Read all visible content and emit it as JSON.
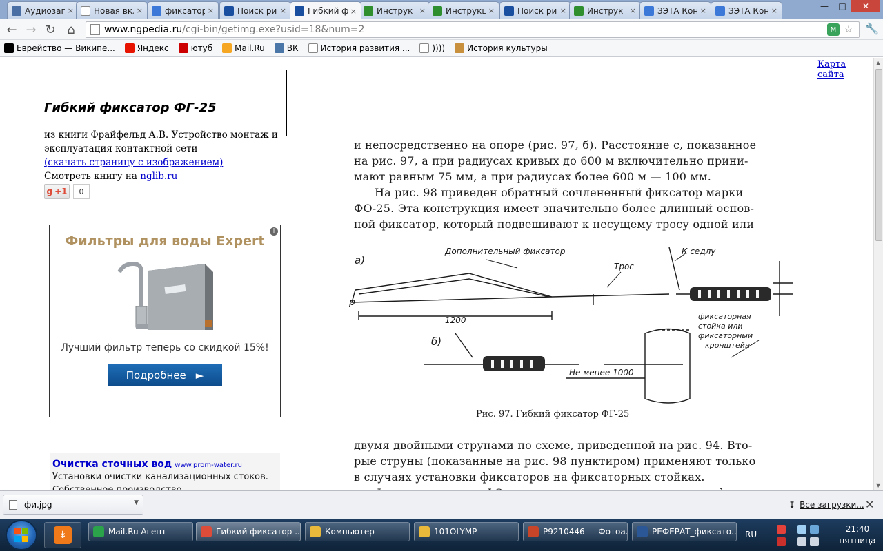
{
  "tabs": [
    {
      "label": "Аудиозаписи",
      "icon": "pause-icon",
      "color": "#4a6fa5"
    },
    {
      "label": "Новая вкладка",
      "icon": "blank-page-icon",
      "color": "#ffffff"
    },
    {
      "label": "фиксатор",
      "icon": "google-icon",
      "color": "#3c78d8"
    },
    {
      "label": "Поиск ри",
      "icon": "ngpedia-icon",
      "color": "#1a4fa0"
    },
    {
      "label": "Гибкий ф",
      "icon": "ngpedia-icon",
      "color": "#1a4fa0",
      "active": true
    },
    {
      "label": "Инструк",
      "icon": "gear-flower-icon",
      "color": "#2f8f2f"
    },
    {
      "label": "Инструкц",
      "icon": "gear-flower-icon",
      "color": "#2f8f2f"
    },
    {
      "label": "Поиск ри",
      "icon": "ngpedia-icon",
      "color": "#1a4fa0"
    },
    {
      "label": "Инструк",
      "icon": "gear-flower-icon",
      "color": "#2f8f2f"
    },
    {
      "label": "ЗЭТА Кон",
      "icon": "google-icon",
      "color": "#3c78d8"
    },
    {
      "label": "ЗЭТА Кон",
      "icon": "google-icon",
      "color": "#3c78d8"
    }
  ],
  "url": {
    "host": "www.ngpedia.ru",
    "path": "/cgi-bin/getimg.exe?usid=18&num=2"
  },
  "bookmarks": [
    {
      "label": "Еврейство — Википе...",
      "icon": "wikipedia-icon",
      "color": "#000000"
    },
    {
      "label": "Яндекс",
      "icon": "yandex-icon",
      "color": "#e61400"
    },
    {
      "label": "ютуб",
      "icon": "youtube-icon",
      "color": "#cc0000"
    },
    {
      "label": "Mail.Ru",
      "icon": "mailru-icon",
      "color": "#f5a623"
    },
    {
      "label": "ВК",
      "icon": "vk-icon",
      "color": "#4a76a8"
    },
    {
      "label": "История развития ...",
      "icon": "page-icon",
      "color": "#ffffff"
    },
    {
      "label": "))))",
      "icon": "page-icon",
      "color": "#ffffff"
    },
    {
      "label": "История культуры",
      "icon": "book-icon",
      "color": "#c8903c"
    }
  ],
  "page": {
    "sitemap": "Карта сайта",
    "title": "Гибкий фиксатор ФГ-25",
    "source_line1": "из книги Фрайфельд А.В. Устройство монтаж и",
    "source_line2": "эксплуатация контактной сети",
    "download_link": "(скачать страницу с изображением)",
    "view_book_prefix": "Смотреть книгу на",
    "view_book_link": "nglib.ru",
    "gplus_label": "+1",
    "gplus_count": "0"
  },
  "ad": {
    "title": "Фильтры для воды Expert",
    "subtitle": "Лучший фильтр теперь со скидкой 15%!",
    "button": "Подробнее",
    "info": "i"
  },
  "text_ad": {
    "title": "Очистка сточных вод",
    "host": "www.prom-water.ru",
    "line1": "Установки очистки канализационных стоков.",
    "line2": "Собственное производство."
  },
  "scan": {
    "para1": [
      "и непосредственно на опоре (рис. 97, б). Расстояние c, показанное",
      "на рис. 97, а при радиусах кривых до 600 м включительно прини-",
      "мают равным 75 мм, а при радиусах более 600 м — 100 мм."
    ],
    "para2": [
      "На рис. 98 приведен обратный сочлененный фиксатор марки",
      "ФО-25. Эта конструкция имеет значительно более длинный основ-",
      "ной фиксатор, который подвешивают к несущему тросу одной или"
    ],
    "figure": {
      "label_a": "а)",
      "label_b": "б)",
      "label_p": "р",
      "extra_fixator": "Дополнительный фиксатор",
      "k_sedlu": "К седлу",
      "tros": "Трос",
      "dim_1200": "1200",
      "not_less": "Не менее 1000",
      "side_label": [
        "фиксаторная",
        "стойка или",
        "фиксаторный",
        "кронштейн"
      ],
      "caption": "Рис. 97. Гибкий фиксатор ФГ-25"
    },
    "para3": [
      "двумя двойными струнами по схеме, приведенной на рис. 94. Вто-",
      "рые струны (показанные на рис. 98 пунктиром) применяют только",
      "в случаях установки фиксаторов на фиксаторных стойках.",
      "Фиксаторы марки ФО выполняют пяти типов с размером l"
    ]
  },
  "download": {
    "file": "фи.jpg",
    "all": "Все загрузки..."
  },
  "taskbar": {
    "tasks": [
      {
        "label": "Mail.Ru Агент",
        "icon": "mailru-agent-icon",
        "color": "#2aa34a"
      },
      {
        "label": "Гибкий фиксатор ...",
        "icon": "chrome-icon",
        "color": "#dd4b39",
        "active": true
      },
      {
        "label": "Компьютер",
        "icon": "folder-icon",
        "color": "#e8b93a"
      },
      {
        "label": "101OLYMP",
        "icon": "folder-icon",
        "color": "#e8b93a"
      },
      {
        "label": "P9210446 — Фотоа...",
        "icon": "photo-viewer-icon",
        "color": "#c8452a"
      },
      {
        "label": "РЕФЕРАТ_фиксато...",
        "icon": "word-icon",
        "color": "#2b5797"
      }
    ],
    "lang": "RU",
    "time": "21:40",
    "day": "пятница"
  }
}
